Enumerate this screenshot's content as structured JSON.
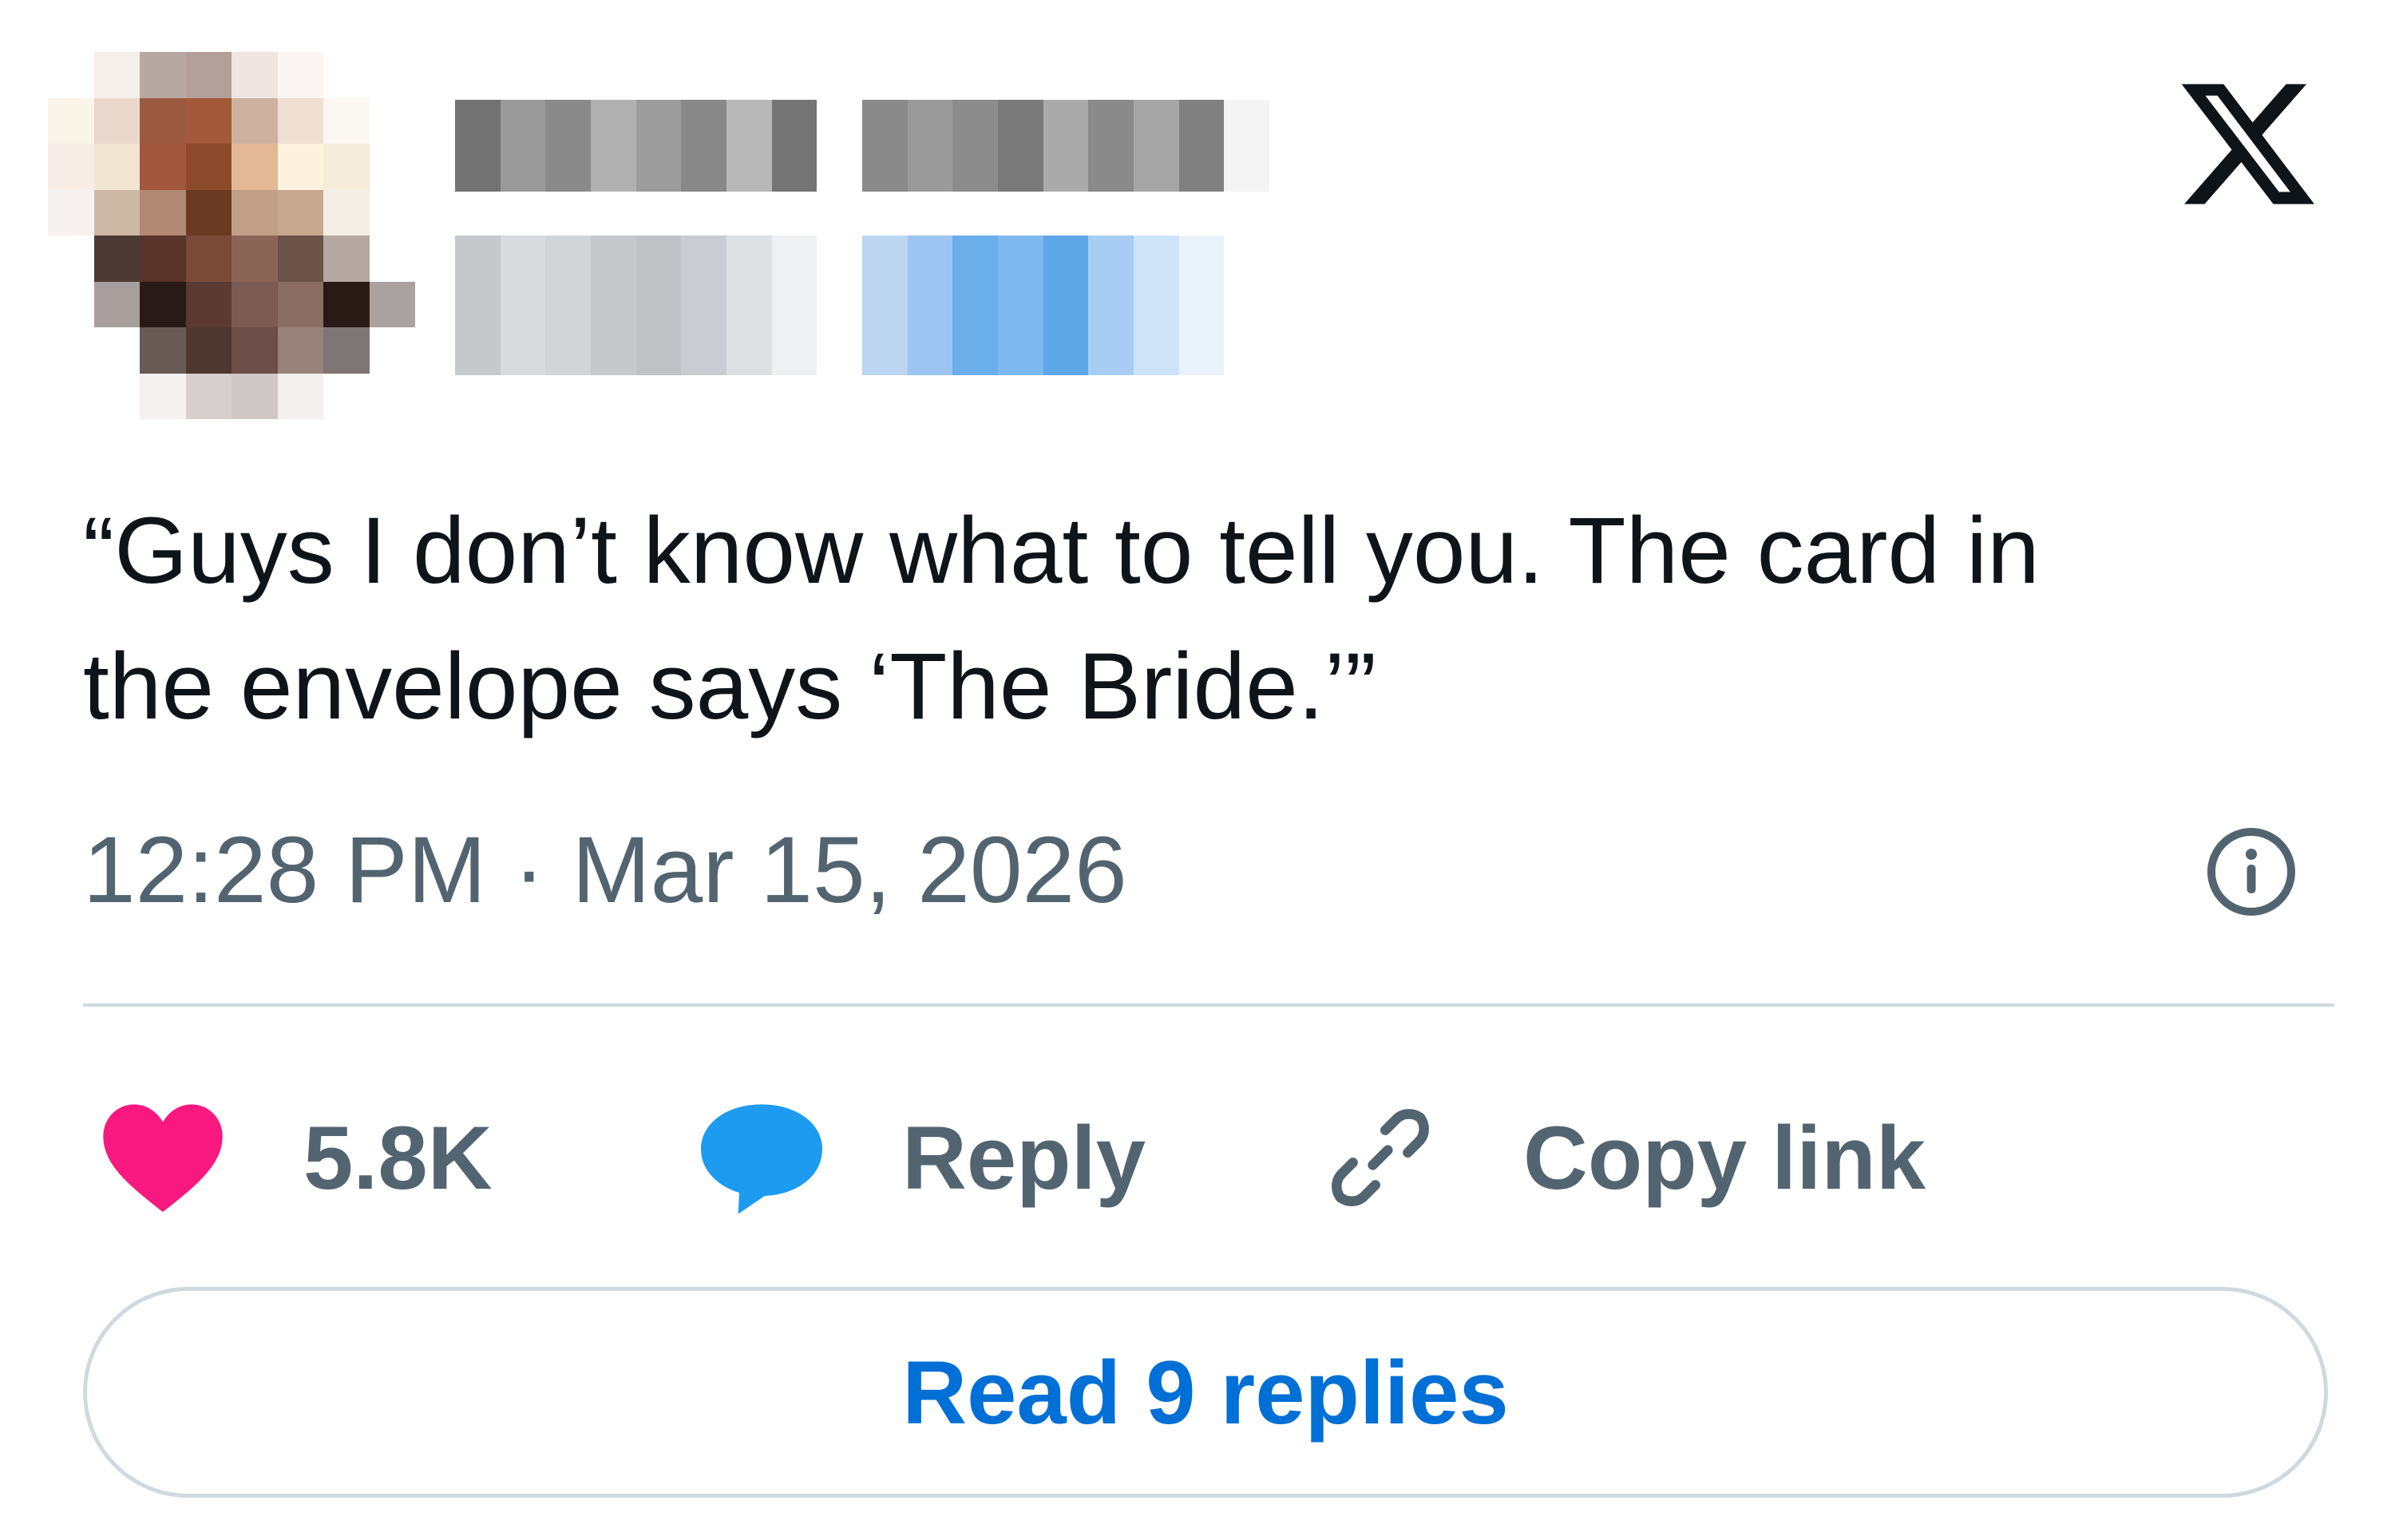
{
  "tweet": {
    "text_line1": "“Guys I don’t know what to tell you. The card in",
    "text_line2": "the envelope says ‘The Bride.’”",
    "time": "12:28 PM",
    "separator": "·",
    "date": "Mar 15, 2026"
  },
  "icons": {
    "brand": "x-logo-icon",
    "info": "info-icon",
    "like": "heart-icon",
    "reply": "speech-bubble-icon",
    "copy": "link-icon"
  },
  "actions": {
    "like_count": "5.8K",
    "reply_label": "Reply",
    "copy_label": "Copy link"
  },
  "read_replies_label": "Read 9 replies",
  "colors": {
    "text": "#0f1419",
    "secondary": "#536471",
    "like": "#f91880",
    "reply": "#1d9bf0",
    "link": "#006fd6",
    "border": "#cfd9de"
  }
}
